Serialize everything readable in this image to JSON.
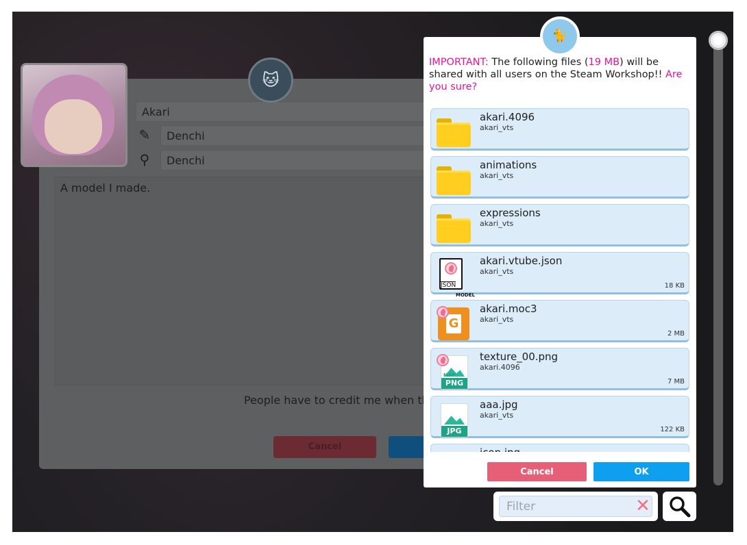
{
  "background_dialog": {
    "name_value": "Akari",
    "artist_value": "Denchi",
    "rigger_value": "Denchi",
    "description": "A model I made.",
    "credit_text": "People have to credit me when they u",
    "cancel_label": "Cancel"
  },
  "modal": {
    "message_important": "IMPORTANT:",
    "message_part1": " The following files (",
    "message_size": "19 MB",
    "message_part2": ") will be shared with all users on the Steam Workshop!! ",
    "message_question": "Are you sure?",
    "files": [
      {
        "name": "akari.4096",
        "parent": "akari_vts",
        "size": "",
        "icon": "folder-icon"
      },
      {
        "name": "animations",
        "parent": "akari_vts",
        "size": "",
        "icon": "folder-icon"
      },
      {
        "name": "expressions",
        "parent": "akari_vts",
        "size": "",
        "icon": "folder-icon"
      },
      {
        "name": "akari.vtube.json",
        "parent": "akari_vts",
        "size": "18 KB",
        "icon": "json-model-file-icon",
        "icon_text": "JSON",
        "icon_subtext": "MODEL"
      },
      {
        "name": "akari.moc3",
        "parent": "akari_vts",
        "size": "2 MB",
        "icon": "moc3-file-icon",
        "icon_text": "G"
      },
      {
        "name": "texture_00.png",
        "parent": "akari.4096",
        "size": "7 MB",
        "icon": "png-texture-file-icon",
        "icon_text": "PNG",
        "icon_subtext": "MAP"
      },
      {
        "name": "aaa.jpg",
        "parent": "akari_vts",
        "size": "122 KB",
        "icon": "jpg-file-icon",
        "icon_text": "JPG"
      },
      {
        "name": "icon.jpg",
        "parent": "",
        "size": "",
        "icon": "jpg-file-icon"
      }
    ],
    "cancel_label": "Cancel",
    "ok_label": "OK"
  },
  "filter": {
    "placeholder": "Filter",
    "clear_icon": "close-x-icon",
    "search_icon": "magnifier-icon"
  },
  "colors": {
    "accent_pink": "#e8129d",
    "ok_blue": "#0ea0ef",
    "cancel_red": "#e56077",
    "item_bg": "#dcecf9"
  }
}
